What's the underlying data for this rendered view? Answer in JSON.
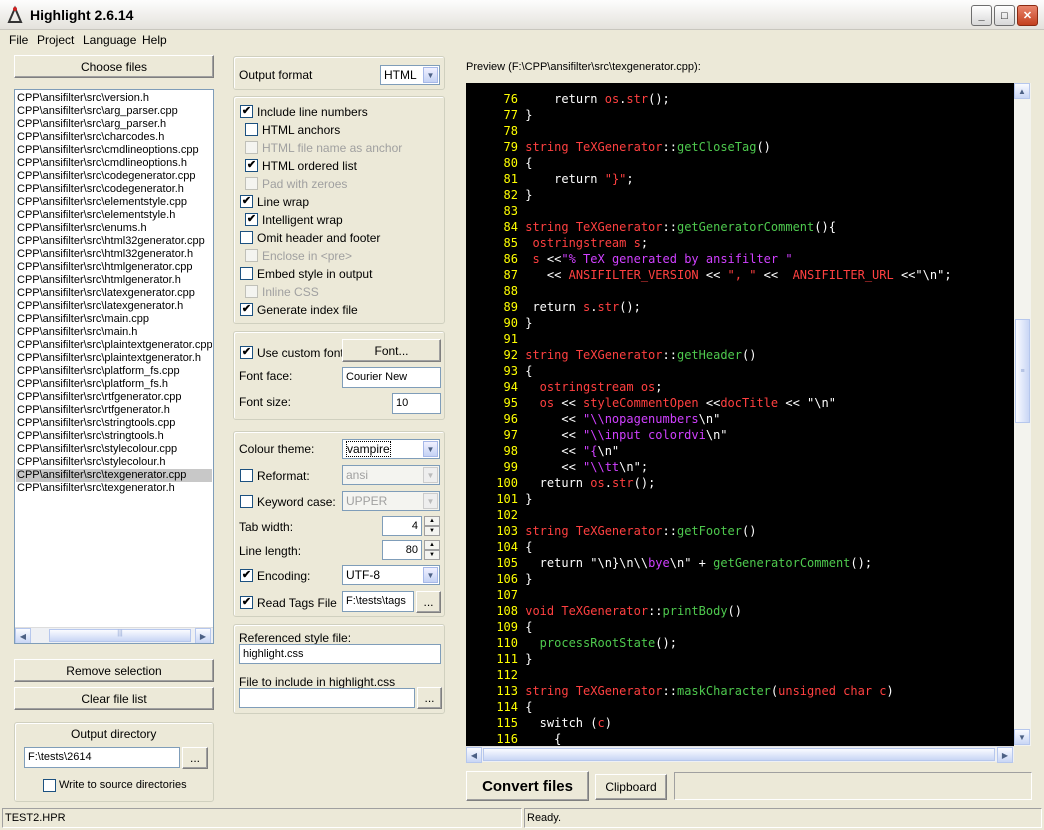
{
  "window": {
    "title": "Highlight 2.6.14"
  },
  "menu": [
    "File",
    "Project",
    "Language",
    "Help"
  ],
  "files": {
    "choose_label": "Choose files",
    "items": [
      "CPP\\ansifilter\\src\\version.h",
      "CPP\\ansifilter\\src\\arg_parser.cpp",
      "CPP\\ansifilter\\src\\arg_parser.h",
      "CPP\\ansifilter\\src\\charcodes.h",
      "CPP\\ansifilter\\src\\cmdlineoptions.cpp",
      "CPP\\ansifilter\\src\\cmdlineoptions.h",
      "CPP\\ansifilter\\src\\codegenerator.cpp",
      "CPP\\ansifilter\\src\\codegenerator.h",
      "CPP\\ansifilter\\src\\elementstyle.cpp",
      "CPP\\ansifilter\\src\\elementstyle.h",
      "CPP\\ansifilter\\src\\enums.h",
      "CPP\\ansifilter\\src\\html32generator.cpp",
      "CPP\\ansifilter\\src\\html32generator.h",
      "CPP\\ansifilter\\src\\htmlgenerator.cpp",
      "CPP\\ansifilter\\src\\htmlgenerator.h",
      "CPP\\ansifilter\\src\\latexgenerator.cpp",
      "CPP\\ansifilter\\src\\latexgenerator.h",
      "CPP\\ansifilter\\src\\main.cpp",
      "CPP\\ansifilter\\src\\main.h",
      "CPP\\ansifilter\\src\\plaintextgenerator.cpp",
      "CPP\\ansifilter\\src\\plaintextgenerator.h",
      "CPP\\ansifilter\\src\\platform_fs.cpp",
      "CPP\\ansifilter\\src\\platform_fs.h",
      "CPP\\ansifilter\\src\\rtfgenerator.cpp",
      "CPP\\ansifilter\\src\\rtfgenerator.h",
      "CPP\\ansifilter\\src\\stringtools.cpp",
      "CPP\\ansifilter\\src\\stringtools.h",
      "CPP\\ansifilter\\src\\stylecolour.cpp",
      "CPP\\ansifilter\\src\\stylecolour.h",
      "CPP\\ansifilter\\src\\texgenerator.cpp",
      "CPP\\ansifilter\\src\\texgenerator.h"
    ],
    "selected_index": 29,
    "remove_label": "Remove selection",
    "clear_label": "Clear file list"
  },
  "output_dir": {
    "title": "Output directory",
    "value": "F:\\tests\\2614",
    "browse": "...",
    "write_to_source": "Write to source directories"
  },
  "options": {
    "output_format_label": "Output format",
    "output_format_value": "HTML",
    "include_line_numbers": "Include line numbers",
    "html_anchors": "HTML anchors",
    "html_file_name_anchor": "HTML file name as anchor",
    "html_ordered_list": "HTML ordered list",
    "pad_with_zeroes": "Pad with zeroes",
    "line_wrap": "Line wrap",
    "intelligent_wrap": "Intelligent wrap",
    "omit_header": "Omit header and footer",
    "enclose_pre": "Enclose in <pre>",
    "embed_style": "Embed style in output",
    "inline_css": "Inline CSS",
    "generate_index": "Generate index file",
    "check_mark": "✔"
  },
  "font": {
    "use_custom": "Use custom font",
    "font_button": "Font...",
    "face_label": "Font face:",
    "face_value": "Courier New",
    "size_label": "Font size:",
    "size_value": "10"
  },
  "theme": {
    "colour_label": "Colour theme:",
    "colour_value": "vampire",
    "reformat_label": "Reformat:",
    "reformat_value": "ansi",
    "keyword_label": "Keyword case:",
    "keyword_value": "UPPER",
    "tab_label": "Tab width:",
    "tab_value": "4",
    "line_length_label": "Line length:",
    "line_length_value": "80",
    "encoding_label": "Encoding:",
    "encoding_value": "UTF-8",
    "tags_label": "Read Tags File",
    "tags_value": "F:\\tests\\tags",
    "tags_browse": "..."
  },
  "style_file": {
    "ref_label": "Referenced style file:",
    "ref_value": "highlight.css",
    "include_label": "File to include in highlight.css",
    "include_value": "",
    "include_browse": "..."
  },
  "preview": {
    "label": "Preview (F:\\CPP\\ansifilter\\src\\texgenerator.cpp):",
    "lines": [
      {
        "n": "76",
        "t": [
          [
            "    ",
            "#fff"
          ],
          [
            "return ",
            "#fff"
          ],
          [
            "os",
            "#ff4040"
          ],
          [
            ".",
            "#fff"
          ],
          [
            "str",
            "#ff4040"
          ],
          [
            "();",
            "#fff"
          ]
        ]
      },
      {
        "n": "77",
        "t": [
          [
            "}",
            "#fff"
          ]
        ]
      },
      {
        "n": "78",
        "t": []
      },
      {
        "n": "79",
        "t": [
          [
            "string ",
            "#ff4040"
          ],
          [
            "TeXGenerator",
            "#ff4040"
          ],
          [
            "::",
            "#fff"
          ],
          [
            "getCloseTag",
            "#4ec94e"
          ],
          [
            "()",
            "#fff"
          ]
        ]
      },
      {
        "n": "80",
        "t": [
          [
            "{",
            "#fff"
          ]
        ]
      },
      {
        "n": "81",
        "t": [
          [
            "    ",
            "#fff"
          ],
          [
            "return ",
            "#fff"
          ],
          [
            "\"}\"",
            "#ff4040"
          ],
          [
            ";",
            "#fff"
          ]
        ]
      },
      {
        "n": "82",
        "t": [
          [
            "}",
            "#fff"
          ]
        ]
      },
      {
        "n": "83",
        "t": []
      },
      {
        "n": "84",
        "t": [
          [
            "string ",
            "#ff4040"
          ],
          [
            "TeXGenerator",
            "#ff4040"
          ],
          [
            "::",
            "#fff"
          ],
          [
            "getGeneratorComment",
            "#4ec94e"
          ],
          [
            "(){",
            "#fff"
          ]
        ]
      },
      {
        "n": "85",
        "t": [
          [
            " ostringstream ",
            "#ff4040"
          ],
          [
            "s",
            "#ff4040"
          ],
          [
            ";",
            "#fff"
          ]
        ]
      },
      {
        "n": "86",
        "t": [
          [
            " s ",
            "#ff4040"
          ],
          [
            "<<",
            "#fff"
          ],
          [
            "\"% TeX generated by ansifilter \"",
            "#d040ff"
          ]
        ]
      },
      {
        "n": "87",
        "t": [
          [
            "   << ",
            "#fff"
          ],
          [
            "ANSIFILTER_VERSION",
            "#ff4040"
          ],
          [
            " << ",
            "#fff"
          ],
          [
            "\", \"",
            "#ff4040"
          ],
          [
            " <<  ",
            "#fff"
          ],
          [
            "ANSIFILTER_URL",
            "#ff4040"
          ],
          [
            " <<",
            "#fff"
          ],
          [
            "\"\\n\"",
            "#fff"
          ],
          [
            ";",
            "#fff"
          ]
        ]
      },
      {
        "n": "88",
        "t": []
      },
      {
        "n": "89",
        "t": [
          [
            " return ",
            "#fff"
          ],
          [
            "s",
            "#ff4040"
          ],
          [
            ".",
            "#fff"
          ],
          [
            "str",
            "#ff4040"
          ],
          [
            "();",
            "#fff"
          ]
        ]
      },
      {
        "n": "90",
        "t": [
          [
            "}",
            "#fff"
          ]
        ]
      },
      {
        "n": "91",
        "t": []
      },
      {
        "n": "92",
        "t": [
          [
            "string ",
            "#ff4040"
          ],
          [
            "TeXGenerator",
            "#ff4040"
          ],
          [
            "::",
            "#fff"
          ],
          [
            "getHeader",
            "#4ec94e"
          ],
          [
            "()",
            "#fff"
          ]
        ]
      },
      {
        "n": "93",
        "t": [
          [
            "{",
            "#fff"
          ]
        ]
      },
      {
        "n": "94",
        "t": [
          [
            "  ostringstream ",
            "#ff4040"
          ],
          [
            "os",
            "#ff4040"
          ],
          [
            ";",
            "#fff"
          ]
        ]
      },
      {
        "n": "95",
        "t": [
          [
            "  os ",
            "#ff4040"
          ],
          [
            "<< ",
            "#fff"
          ],
          [
            "styleCommentOpen",
            "#ff4040"
          ],
          [
            " <<",
            "#fff"
          ],
          [
            "docTitle",
            "#ff4040"
          ],
          [
            " << ",
            "#fff"
          ],
          [
            "\"\\n\"",
            "#fff"
          ]
        ]
      },
      {
        "n": "96",
        "t": [
          [
            "     << ",
            "#fff"
          ],
          [
            "\"\\\\nopagenumbers",
            "#d040ff"
          ],
          [
            "\\n\"",
            "#fff"
          ]
        ]
      },
      {
        "n": "97",
        "t": [
          [
            "     << ",
            "#fff"
          ],
          [
            "\"\\\\input colordvi",
            "#d040ff"
          ],
          [
            "\\n\"",
            "#fff"
          ]
        ]
      },
      {
        "n": "98",
        "t": [
          [
            "     << ",
            "#fff"
          ],
          [
            "\"{",
            "#d040ff"
          ],
          [
            "\\n\"",
            "#fff"
          ]
        ]
      },
      {
        "n": "99",
        "t": [
          [
            "     << ",
            "#fff"
          ],
          [
            "\"\\\\tt",
            "#d040ff"
          ],
          [
            "\\n\"",
            "#fff"
          ],
          [
            ";",
            "#fff"
          ]
        ]
      },
      {
        "n": "100",
        "t": [
          [
            "  return ",
            "#fff"
          ],
          [
            "os",
            "#ff4040"
          ],
          [
            ".",
            "#fff"
          ],
          [
            "str",
            "#ff4040"
          ],
          [
            "();",
            "#fff"
          ]
        ]
      },
      {
        "n": "101",
        "t": [
          [
            "}",
            "#fff"
          ]
        ]
      },
      {
        "n": "102",
        "t": []
      },
      {
        "n": "103",
        "t": [
          [
            "string ",
            "#ff4040"
          ],
          [
            "TeXGenerator",
            "#ff4040"
          ],
          [
            "::",
            "#fff"
          ],
          [
            "getFooter",
            "#4ec94e"
          ],
          [
            "()",
            "#fff"
          ]
        ]
      },
      {
        "n": "104",
        "t": [
          [
            "{",
            "#fff"
          ]
        ]
      },
      {
        "n": "105",
        "t": [
          [
            "  return ",
            "#fff"
          ],
          [
            "\"\\n}",
            "#fff"
          ],
          [
            "\\n\\\\",
            "#fff"
          ],
          [
            "bye",
            "#d040ff"
          ],
          [
            "\\n\"",
            "#fff"
          ],
          [
            " + ",
            "#fff"
          ],
          [
            "getGeneratorComment",
            "#4ec94e"
          ],
          [
            "();",
            "#fff"
          ]
        ]
      },
      {
        "n": "106",
        "t": [
          [
            "}",
            "#fff"
          ]
        ]
      },
      {
        "n": "107",
        "t": []
      },
      {
        "n": "108",
        "t": [
          [
            "void ",
            "#ff4040"
          ],
          [
            "TeXGenerator",
            "#ff4040"
          ],
          [
            "::",
            "#fff"
          ],
          [
            "printBody",
            "#4ec94e"
          ],
          [
            "()",
            "#fff"
          ]
        ]
      },
      {
        "n": "109",
        "t": [
          [
            "{",
            "#fff"
          ]
        ]
      },
      {
        "n": "110",
        "t": [
          [
            "  processRootState",
            "#4ec94e"
          ],
          [
            "();",
            "#fff"
          ]
        ]
      },
      {
        "n": "111",
        "t": [
          [
            "}",
            "#fff"
          ]
        ]
      },
      {
        "n": "112",
        "t": []
      },
      {
        "n": "113",
        "t": [
          [
            "string ",
            "#ff4040"
          ],
          [
            "TeXGenerator",
            "#ff4040"
          ],
          [
            "::",
            "#fff"
          ],
          [
            "maskCharacter",
            "#4ec94e"
          ],
          [
            "(",
            "#fff"
          ],
          [
            "unsigned char ",
            "#ff4040"
          ],
          [
            "c",
            "#ff4040"
          ],
          [
            ")",
            "#fff"
          ]
        ]
      },
      {
        "n": "114",
        "t": [
          [
            "{",
            "#fff"
          ]
        ]
      },
      {
        "n": "115",
        "t": [
          [
            "  switch ",
            "#fff"
          ],
          [
            "(",
            "#fff"
          ],
          [
            "c",
            "#ff4040"
          ],
          [
            ")",
            "#fff"
          ]
        ]
      },
      {
        "n": "116",
        "t": [
          [
            "    {",
            "#fff"
          ]
        ]
      }
    ]
  },
  "actions": {
    "convert": "Convert files",
    "clipboard": "Clipboard"
  },
  "status": {
    "project": "TEST2.HPR",
    "state": "Ready."
  },
  "icons": {
    "app": "highlight-app-icon"
  }
}
